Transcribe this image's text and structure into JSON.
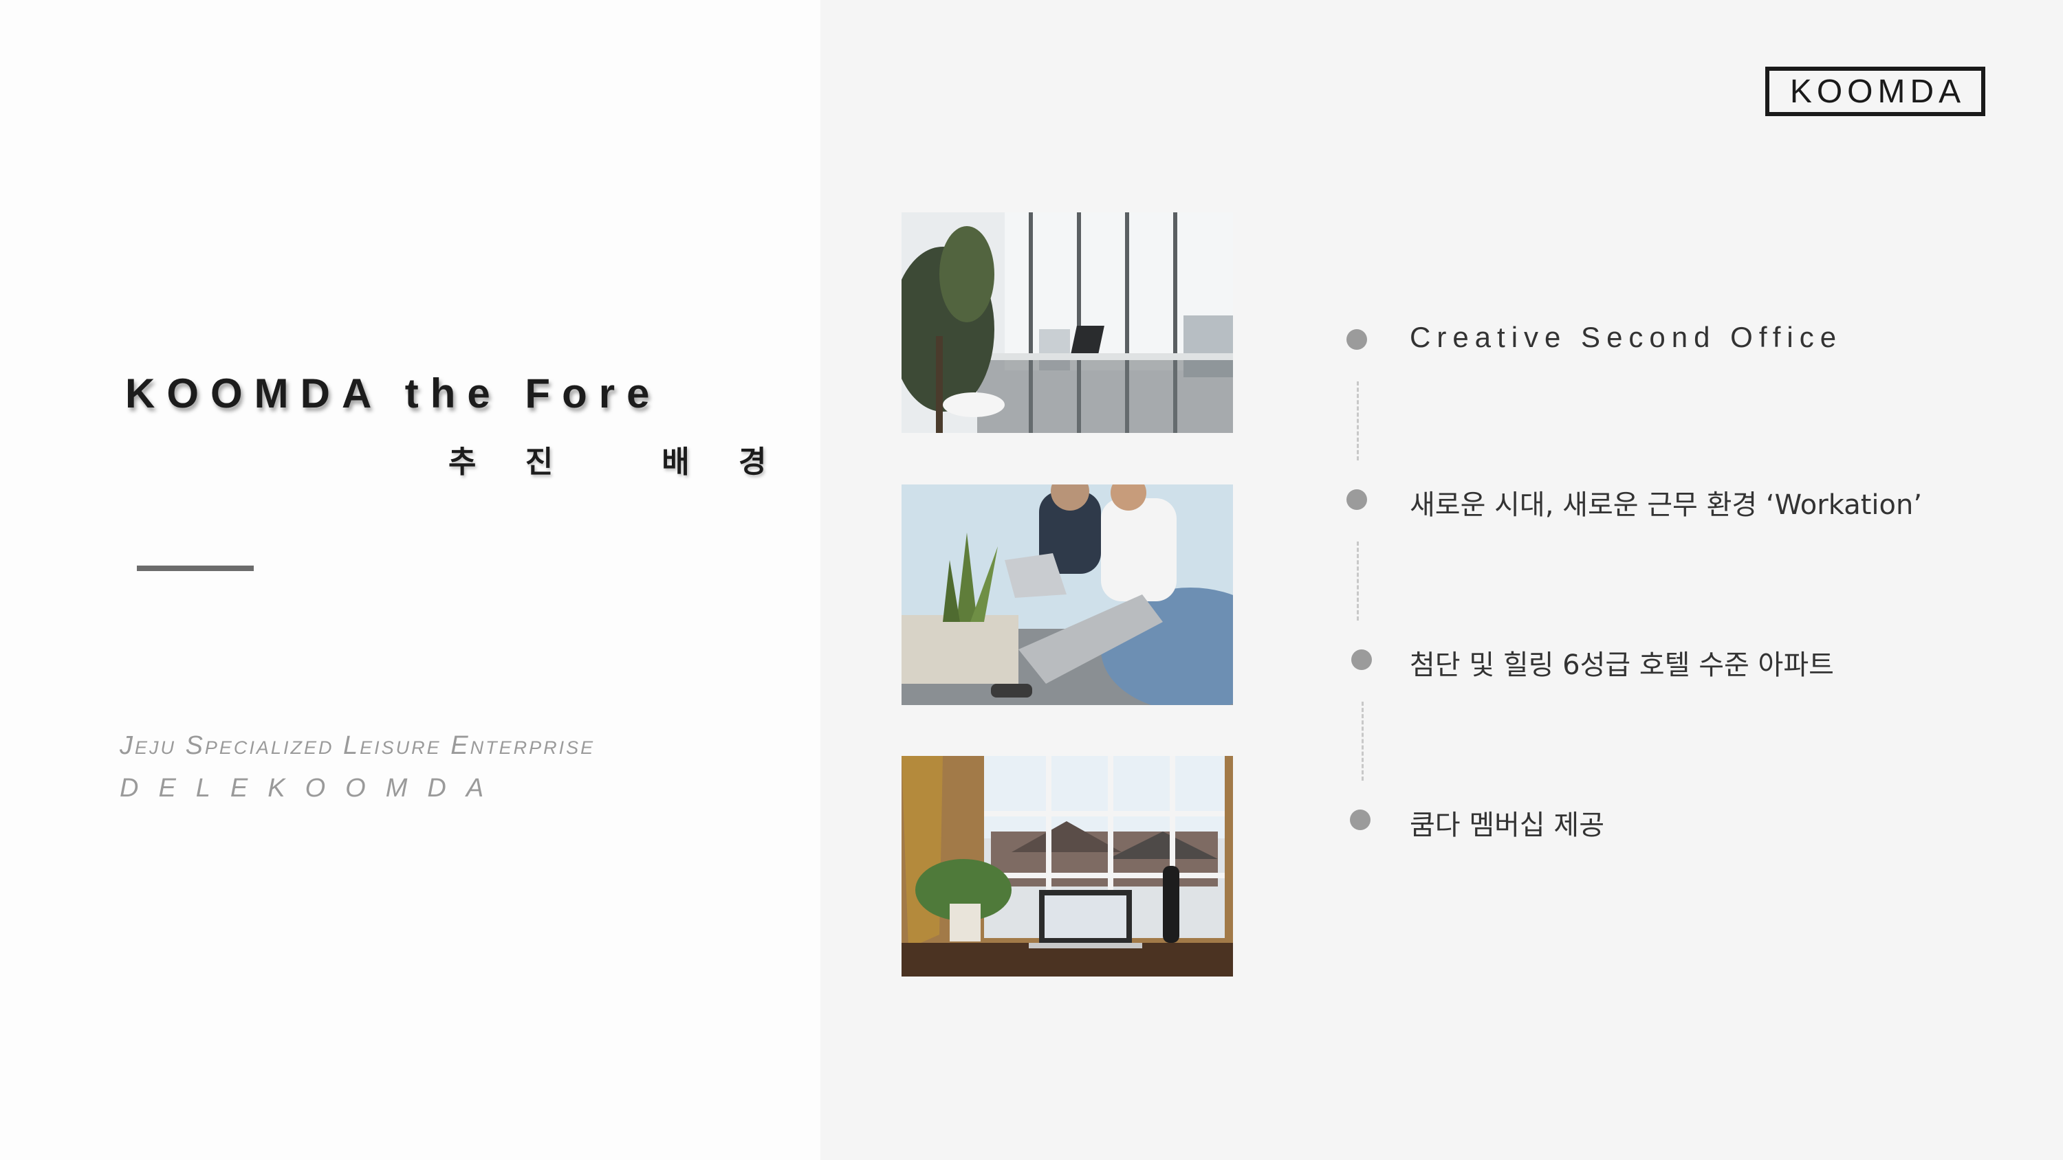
{
  "slide": {
    "title": "KOOMDA the Fore",
    "subtitle": "추 진   배 경",
    "enterprise": "Jeju Specialized Leisure Enterprise",
    "brand_line": "DELEKOOMDA"
  },
  "logo": {
    "text": "KOOMDA"
  },
  "images": [
    {
      "name": "office-window-photo",
      "alt": "Bright office with plants and a laptop by the window"
    },
    {
      "name": "people-working-photo",
      "alt": "Two people working on a laptop on a terrace"
    },
    {
      "name": "window-desk-photo",
      "alt": "Laptop, plant and bottle on a desk by a window"
    }
  ],
  "timeline": {
    "items": [
      {
        "label": "Creative Second Office"
      },
      {
        "label": "새로운 시대, 새로운 근무 환경 ‘Workation’"
      },
      {
        "label": "첨단 및 힐링 6성급 호텔 수준 아파트"
      },
      {
        "label": "쿰다 멤버십 제공"
      }
    ]
  },
  "colors": {
    "right_panel": "#f5f5f5",
    "bullet": "#9b9b9b",
    "accent_line": "#6c6c6c",
    "text_dark": "#1c1c1c",
    "text_muted": "#9a9a9a"
  }
}
